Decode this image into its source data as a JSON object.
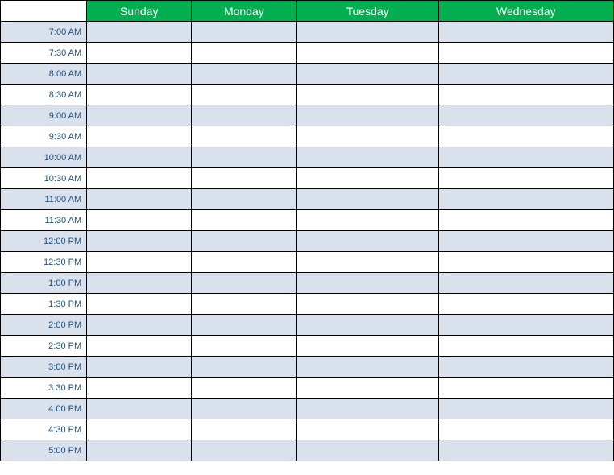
{
  "schedule": {
    "days": [
      "Sunday",
      "Monday",
      "Tuesday",
      "Wednesday"
    ],
    "timeslots": [
      "7:00 AM",
      "7:30 AM",
      "8:00 AM",
      "8:30 AM",
      "9:00 AM",
      "9:30 AM",
      "10:00 AM",
      "10:30 AM",
      "11:00 AM",
      "11:30 AM",
      "12:00 PM",
      "12:30 PM",
      "1:00 PM",
      "1:30 PM",
      "2:00 PM",
      "2:30 PM",
      "3:00 PM",
      "3:30 PM",
      "4:00 PM",
      "4:30 PM",
      "5:00 PM"
    ]
  }
}
